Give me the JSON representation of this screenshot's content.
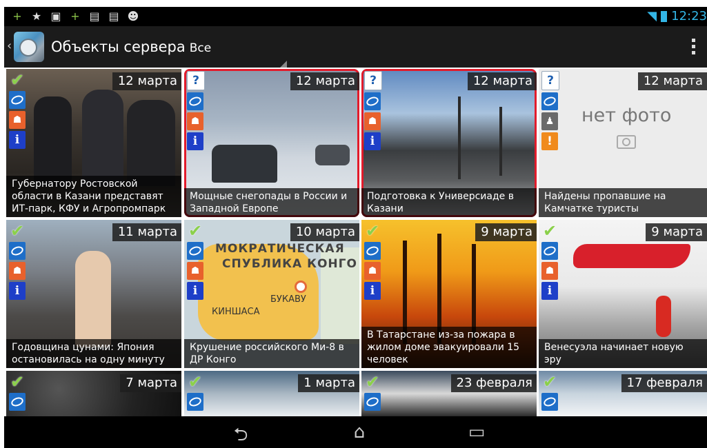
{
  "status": {
    "left_icons": [
      "plus-icon",
      "star-icon",
      "image-icon",
      "plus-icon",
      "briefcase-icon",
      "briefcase-icon",
      "cat-icon"
    ],
    "time": "12:23"
  },
  "actionbar": {
    "title": "Объекты сервера",
    "filter": "Все"
  },
  "colors": {
    "selected_outline": "#e21b2b",
    "actionbar": "#1b1b1b",
    "check": "#8bd04b"
  },
  "tiles": [
    {
      "date": "12 марта",
      "caption": "Губернатору Ростовской области в Казани представят ИТ-парк, КФУ и Агропромпарк",
      "status": "check"
    },
    {
      "date": "12 марта",
      "caption": "Мощные снегопады в России и Западной Европе",
      "status": "question",
      "selected": true
    },
    {
      "date": "12 марта",
      "caption": "Подготовка к Универсиаде в Казани",
      "status": "question",
      "selected": true
    },
    {
      "date": "12 марта",
      "caption": "Найдены пропавшие на Камчатке туристы",
      "status": "question",
      "no_photo_text": "нет фото"
    },
    {
      "date": "11 марта",
      "caption": "Годовщина цунами: Япония остановилась на одну минуту",
      "status": "check"
    },
    {
      "date": "10 марта",
      "caption": "Крушение российского Ми-8 в ДР Конго",
      "status": "check",
      "map_labels": [
        "МОКРАТИЧЕСКАЯ",
        "СПУБЛИКА КОНГО",
        "БУКАВУ",
        "КИНШАСА"
      ]
    },
    {
      "date": "9 марта",
      "caption": "В Татарстане из-за пожара в жилом доме эвакуировали 15 человек",
      "status": "check"
    },
    {
      "date": "9 марта",
      "caption": "Венесуэла начинает новую эру",
      "status": "check"
    },
    {
      "date": "7 марта",
      "status": "check"
    },
    {
      "date": "1 марта",
      "status": "check"
    },
    {
      "date": "23 февраля",
      "status": "check"
    },
    {
      "date": "17 февраля",
      "status": "check"
    }
  ],
  "navbar": [
    "back-icon",
    "home-icon",
    "recent-apps-icon"
  ]
}
